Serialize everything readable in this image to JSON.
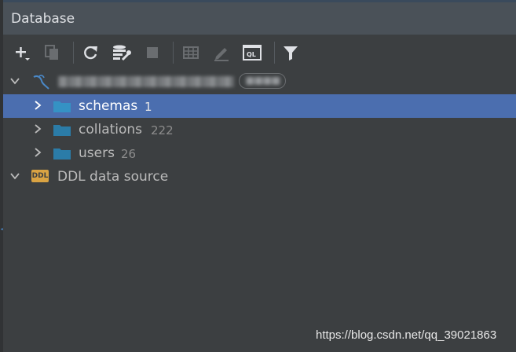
{
  "window": {
    "title": "Database"
  },
  "toolbar": {
    "buttons": [
      {
        "icon": "add-icon",
        "tooltip": ""
      },
      {
        "icon": "duplicate-icon",
        "tooltip": ""
      },
      {
        "icon": "refresh-icon",
        "tooltip": ""
      },
      {
        "icon": "data-source-properties-icon",
        "tooltip": ""
      },
      {
        "icon": "stop-icon",
        "tooltip": ""
      },
      {
        "icon": "table-icon",
        "tooltip": ""
      },
      {
        "icon": "edit-icon",
        "tooltip": ""
      },
      {
        "icon": "query-console-icon",
        "tooltip": ""
      },
      {
        "icon": "filter-icon",
        "tooltip": ""
      }
    ],
    "console_icon_text": "QL"
  },
  "tree": {
    "root": {
      "name_blurred": true,
      "badge_blurred": true,
      "icon": "mysql-icon",
      "expanded": true
    },
    "children": [
      {
        "label": "schemas",
        "count": "1",
        "selected": true,
        "icon": "folder-icon"
      },
      {
        "label": "collations",
        "count": "222",
        "selected": false,
        "icon": "folder-icon"
      },
      {
        "label": "users",
        "count": "26",
        "selected": false,
        "icon": "folder-icon"
      }
    ],
    "ddl_source": {
      "label": "DDL data source",
      "icon_text": "DDL",
      "expanded": true
    }
  },
  "watermark": "https://blog.csdn.net/qq_39021863",
  "colors": {
    "background": "#3c3f41",
    "titlebar": "#4a5158",
    "selection": "#4b6eaf",
    "folder": "#3592c4",
    "folder_dark": "#2b7ca8",
    "ddl_icon": "#d9a343",
    "mysql_icon": "#4a88c7"
  }
}
